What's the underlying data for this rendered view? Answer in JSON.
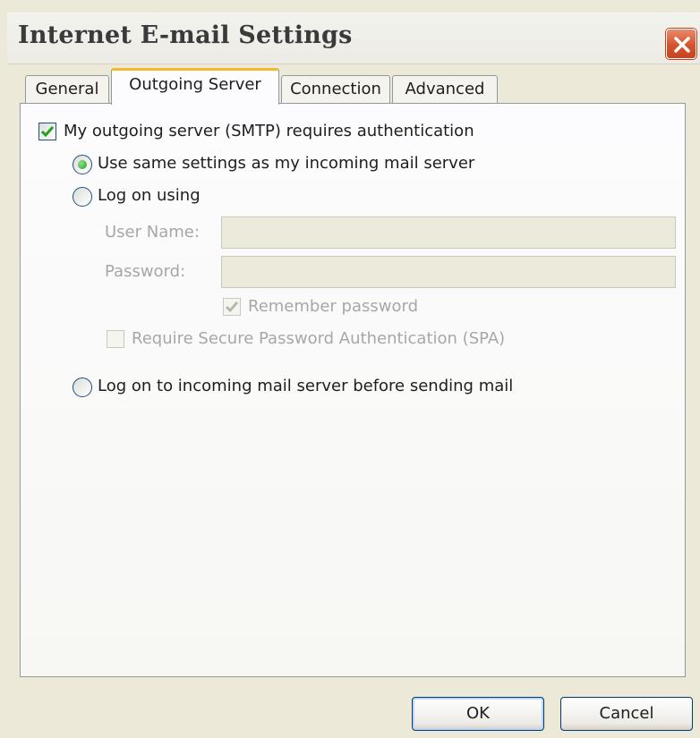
{
  "window": {
    "title": "Internet E-mail Settings",
    "close_icon": "close-x-icon"
  },
  "tabs": [
    {
      "label": "General",
      "selected": false
    },
    {
      "label": "Outgoing Server",
      "selected": true
    },
    {
      "label": "Connection",
      "selected": false
    },
    {
      "label": "Advanced",
      "selected": false
    }
  ],
  "outgoing": {
    "smtp_auth": {
      "label": "My outgoing server (SMTP) requires authentication",
      "checked": true
    },
    "same_settings": {
      "label": "Use same settings as my incoming mail server",
      "selected": true
    },
    "log_on_using": {
      "label": "Log on using",
      "selected": false
    },
    "username": {
      "label": "User Name:",
      "value": "",
      "enabled": false
    },
    "password": {
      "label": "Password:",
      "value": "",
      "enabled": false
    },
    "remember_password": {
      "label": "Remember password",
      "checked": true,
      "enabled": false
    },
    "spa": {
      "label": "Require Secure Password Authentication (SPA)",
      "checked": false,
      "enabled": false
    },
    "log_on_incoming_first": {
      "label": "Log on to incoming mail server before sending mail",
      "selected": false
    }
  },
  "buttons": {
    "ok": "OK",
    "cancel": "Cancel"
  },
  "colors": {
    "dialog_bg": "#ece9d8",
    "active_tab_accent": "#f4b82e",
    "close_button": "#d5542e",
    "checkmark": "#21a121",
    "disabled_text": "#a7a6aa"
  }
}
